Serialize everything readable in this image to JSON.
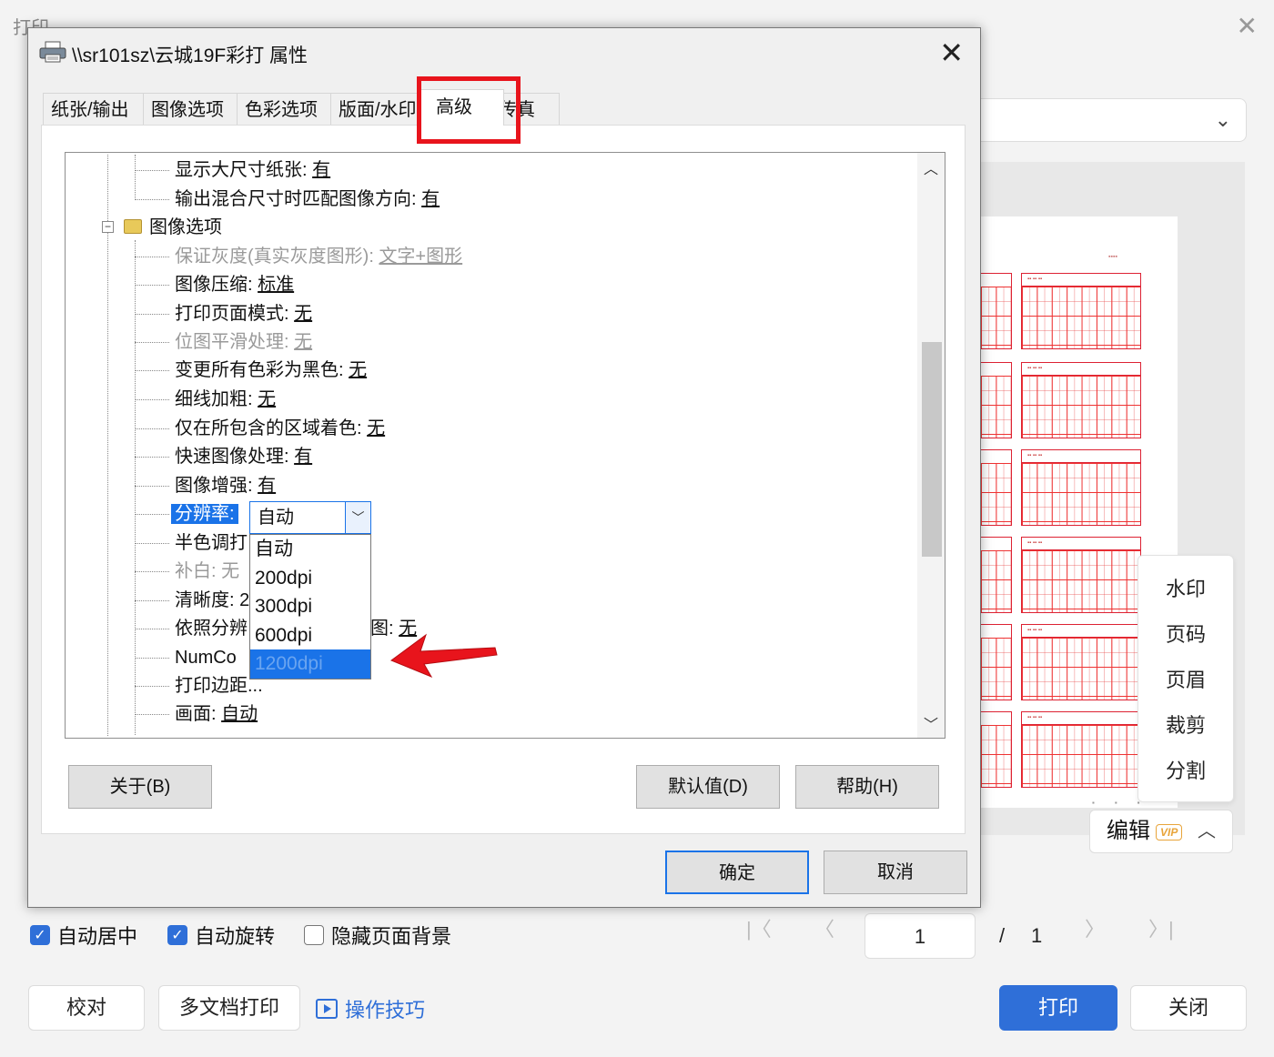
{
  "background_window": {
    "title": "打印",
    "side_menu": [
      "水印",
      "页码",
      "页眉",
      "裁剪",
      "分割"
    ],
    "edit_label": "编辑",
    "vip_badge": "VIP",
    "options": [
      {
        "label": "自动居中",
        "checked": true
      },
      {
        "label": "自动旋转",
        "checked": true
      },
      {
        "label": "隐藏页面背景",
        "checked": false
      }
    ],
    "pager": {
      "current": "1",
      "separator": "/",
      "total": "1"
    },
    "buttons": {
      "proofread": "校对",
      "multi_print": "多文档打印",
      "tips": "操作技巧",
      "print": "打印",
      "close": "关闭"
    }
  },
  "dialog": {
    "title": "\\\\sr101sz\\云城19F彩打 属性",
    "tabs": [
      "纸张/输出",
      "图像选项",
      "色彩选项",
      "版面/水印",
      "高级",
      "传真"
    ],
    "active_tab": "高级",
    "tree": [
      {
        "label": "显示大尺寸纸张: ",
        "value": "有",
        "dim": false
      },
      {
        "label": "输出混合尺寸时匹配图像方向: ",
        "value": "有",
        "dim": false
      },
      {
        "label": "图像选项",
        "folder": true
      },
      {
        "label": "保证灰度(真实灰度图形): ",
        "value": "文字+图形",
        "dim": true
      },
      {
        "label": "图像压缩: ",
        "value": "标准",
        "dim": false
      },
      {
        "label": "打印页面模式: ",
        "value": "无",
        "dim": false
      },
      {
        "label": "位图平滑处理: ",
        "value": "无",
        "dim": true
      },
      {
        "label": "变更所有色彩为黑色: ",
        "value": "无",
        "dim": false
      },
      {
        "label": "细线加粗: ",
        "value": "无",
        "dim": false
      },
      {
        "label": "仅在所包含的区域着色: ",
        "value": "无",
        "dim": false
      },
      {
        "label": "快速图像处理: ",
        "value": "有",
        "dim": false
      },
      {
        "label": "图像增强: ",
        "value": "有",
        "dim": false
      },
      {
        "label": "分辨率:",
        "selected": true
      },
      {
        "label": "半色调打",
        "value": "",
        "dim": false
      },
      {
        "label": "补白: 无",
        "value": "",
        "dim": true
      },
      {
        "label": "清晰度: 2",
        "value": "",
        "dim": false
      },
      {
        "label": "依照分辨",
        "suffix": "图: ",
        "value": "无",
        "dim": false
      },
      {
        "label": "NumCo",
        "value": "",
        "dim": false
      },
      {
        "label": "打印边距...",
        "value": "",
        "dim": false
      },
      {
        "label": "画面: ",
        "value": "自动",
        "dim": false
      }
    ],
    "resolution_combo": {
      "value": "自动",
      "options": [
        "自动",
        "200dpi",
        "300dpi",
        "600dpi",
        "1200dpi"
      ],
      "highlighted": "1200dpi"
    },
    "buttons": {
      "about": "关于(B)",
      "defaults": "默认值(D)",
      "help": "帮助(H)",
      "ok": "确定",
      "cancel": "取消"
    }
  },
  "colors": {
    "accent": "#2f6fd8",
    "selection": "#1a73e8",
    "highlight_box": "#e8141c",
    "arrow": "#e8141c"
  }
}
